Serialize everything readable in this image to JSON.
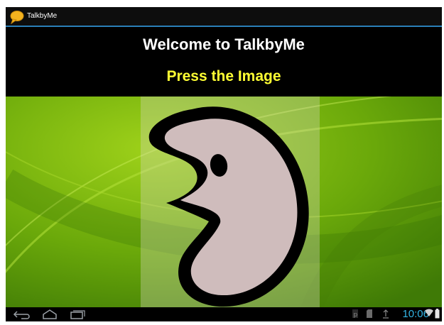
{
  "app": {
    "title": "TalkbyMe"
  },
  "header": {
    "welcome": "Welcome to TalkbyMe",
    "instruction": "Press the Image"
  },
  "status_bar": {
    "time": "10:06"
  },
  "colors": {
    "accent": "#2a7fb8",
    "instruction_text": "#ffff33",
    "clock": "#33b5e5",
    "wallpaper_green": "#6aa80a",
    "mascot_fill": "#cfbcbc"
  },
  "icons": {
    "app": "speech-bubble-icon",
    "nav": [
      "back-icon",
      "home-icon",
      "recent-apps-icon"
    ],
    "status": [
      "p-notification-icon",
      "sd-card-icon",
      "upload-icon",
      "wifi-icon",
      "battery-icon"
    ]
  }
}
